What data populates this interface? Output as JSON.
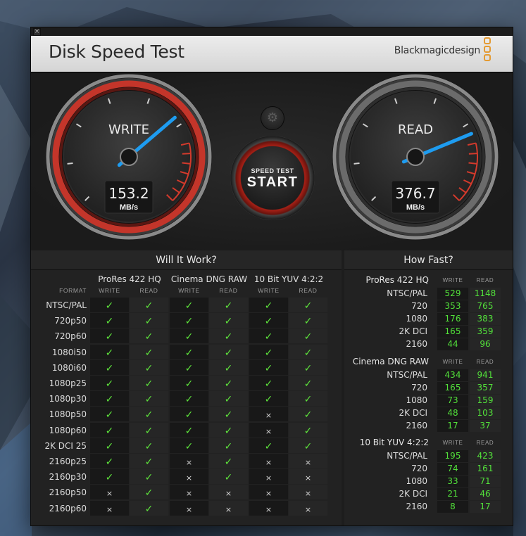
{
  "window": {
    "title": "Disk Speed Test",
    "brand": "Blackmagicdesign",
    "close_glyph": "×"
  },
  "gauges": {
    "write": {
      "label": "WRITE",
      "value": "153.2",
      "unit": "MB/s",
      "needle_mbps": 153.2
    },
    "read": {
      "label": "READ",
      "value": "376.7",
      "unit": "MB/s",
      "needle_mbps": 376.7
    },
    "accent_red": "#d33a2c",
    "needle_blue": "#1e9cf0"
  },
  "start_button": {
    "small_label": "SPEED TEST",
    "big_label": "START"
  },
  "settings_icon": "gear-icon",
  "will_it_work": {
    "title": "Will It Work?",
    "format_label": "FORMAT",
    "groups": [
      "ProRes 422 HQ",
      "Cinema DNG RAW",
      "10 Bit YUV 4:2:2"
    ],
    "write_label": "WRITE",
    "read_label": "READ",
    "rows": [
      {
        "format": "NTSC/PAL",
        "marks": [
          "✓",
          "✓",
          "✓",
          "✓",
          "✓",
          "✓"
        ]
      },
      {
        "format": "720p50",
        "marks": [
          "✓",
          "✓",
          "✓",
          "✓",
          "✓",
          "✓"
        ]
      },
      {
        "format": "720p60",
        "marks": [
          "✓",
          "✓",
          "✓",
          "✓",
          "✓",
          "✓"
        ]
      },
      {
        "format": "1080i50",
        "marks": [
          "✓",
          "✓",
          "✓",
          "✓",
          "✓",
          "✓"
        ]
      },
      {
        "format": "1080i60",
        "marks": [
          "✓",
          "✓",
          "✓",
          "✓",
          "✓",
          "✓"
        ]
      },
      {
        "format": "1080p25",
        "marks": [
          "✓",
          "✓",
          "✓",
          "✓",
          "✓",
          "✓"
        ]
      },
      {
        "format": "1080p30",
        "marks": [
          "✓",
          "✓",
          "✓",
          "✓",
          "✓",
          "✓"
        ]
      },
      {
        "format": "1080p50",
        "marks": [
          "✓",
          "✓",
          "✓",
          "✓",
          "×",
          "✓"
        ]
      },
      {
        "format": "1080p60",
        "marks": [
          "✓",
          "✓",
          "✓",
          "✓",
          "×",
          "✓"
        ]
      },
      {
        "format": "2K DCI 25",
        "marks": [
          "✓",
          "✓",
          "✓",
          "✓",
          "✓",
          "✓"
        ]
      },
      {
        "format": "2160p25",
        "marks": [
          "✓",
          "✓",
          "×",
          "✓",
          "×",
          "×"
        ]
      },
      {
        "format": "2160p30",
        "marks": [
          "✓",
          "✓",
          "×",
          "✓",
          "×",
          "×"
        ]
      },
      {
        "format": "2160p50",
        "marks": [
          "×",
          "✓",
          "×",
          "×",
          "×",
          "×"
        ]
      },
      {
        "format": "2160p60",
        "marks": [
          "×",
          "✓",
          "×",
          "×",
          "×",
          "×"
        ]
      }
    ]
  },
  "how_fast": {
    "title": "How Fast?",
    "write_label": "WRITE",
    "read_label": "READ",
    "groups": [
      {
        "name": "ProRes 422 HQ",
        "rows": [
          {
            "format": "NTSC/PAL",
            "write": "529",
            "read": "1148"
          },
          {
            "format": "720",
            "write": "353",
            "read": "765"
          },
          {
            "format": "1080",
            "write": "176",
            "read": "383"
          },
          {
            "format": "2K DCI",
            "write": "165",
            "read": "359"
          },
          {
            "format": "2160",
            "write": "44",
            "read": "96"
          }
        ]
      },
      {
        "name": "Cinema DNG RAW",
        "rows": [
          {
            "format": "NTSC/PAL",
            "write": "434",
            "read": "941"
          },
          {
            "format": "720",
            "write": "165",
            "read": "357"
          },
          {
            "format": "1080",
            "write": "73",
            "read": "159"
          },
          {
            "format": "2K DCI",
            "write": "48",
            "read": "103"
          },
          {
            "format": "2160",
            "write": "17",
            "read": "37"
          }
        ]
      },
      {
        "name": "10 Bit YUV 4:2:2",
        "rows": [
          {
            "format": "NTSC/PAL",
            "write": "195",
            "read": "423"
          },
          {
            "format": "720",
            "write": "74",
            "read": "161"
          },
          {
            "format": "1080",
            "write": "33",
            "read": "71"
          },
          {
            "format": "2K DCI",
            "write": "21",
            "read": "46"
          },
          {
            "format": "2160",
            "write": "8",
            "read": "17"
          }
        ]
      }
    ]
  }
}
